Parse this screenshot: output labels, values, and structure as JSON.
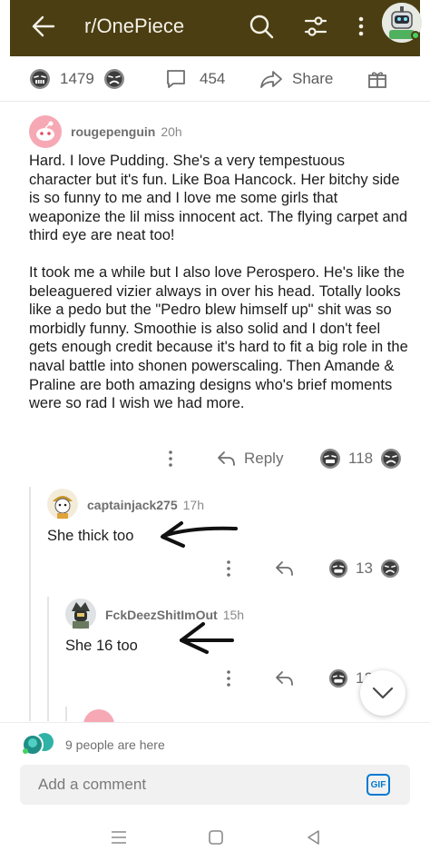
{
  "header": {
    "title": "r/OnePiece",
    "background_color": "#4b3e12"
  },
  "post_actions": {
    "votes": "1479",
    "comments": "454",
    "share_label": "Share"
  },
  "comments": [
    {
      "username": "rougepenguin",
      "time": "20h",
      "paragraphs": [
        "Hard. I love Pudding. She's a very tempestuous character but it's fun. Like Boa Hancock. Her bitchy side is so funny to me and I love me some girls that weaponize the lil miss innocent act. The flying carpet and third eye are neat too!",
        "It took me a while but I also love Perospero. He's like the beleaguered vizier always in over his head. Totally looks like a pedo but the \"Pedro blew himself up\" shit was so morbidly funny. Smoothie is also solid and I don't feel gets enough credit because it's hard to fit a big role in the naval battle into shonen powerscaling. Then Amande & Praline are both amazing designs who's brief moments were so rad I wish we had more."
      ],
      "reply_label": "Reply",
      "votes": "118"
    },
    {
      "username": "captainjack275",
      "time": "17h",
      "text": "She thick too",
      "votes": "13"
    },
    {
      "username": "FckDeezShitImOut",
      "time": "15h",
      "text": "She 16 too",
      "votes": "12"
    }
  ],
  "presence": {
    "text": "9 people are here"
  },
  "composer": {
    "placeholder": "Add a comment",
    "gif_label": "GIF"
  },
  "icons": {
    "back": "arrow-left-icon",
    "search": "search-icon",
    "filter": "sliders-icon",
    "more": "kebab-icon",
    "award": "gift-icon",
    "scroll": "chevron-down-icon"
  }
}
